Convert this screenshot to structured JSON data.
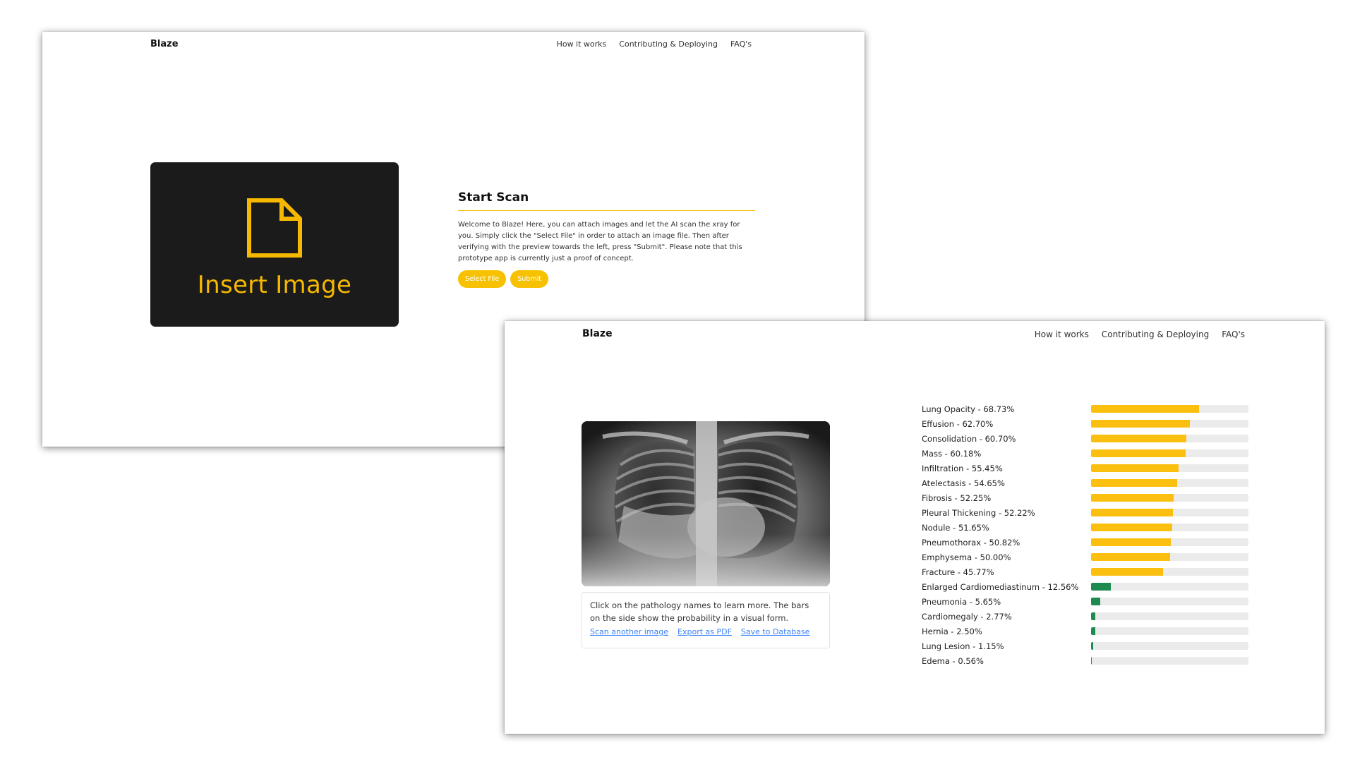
{
  "upload_page": {
    "brand": "Blaze",
    "nav": [
      "How it works",
      "Contributing & Deploying",
      "FAQ's"
    ],
    "dropzone": {
      "icon": "file-icon",
      "label": "Insert Image"
    },
    "panel": {
      "title": "Start Scan",
      "description": "Welcome to Blaze! Here, you can attach images and let the AI scan the xray for you. Simply click the \"Select File\" in order to attach an image file. Then after verifying with the preview towards the left, press \"Submit\". Please note that this prototype app is currently just a proof of concept.",
      "select_label": "Select File",
      "submit_label": "Submit"
    }
  },
  "results_page": {
    "brand": "Blaze",
    "nav": [
      "How it works",
      "Contributing & Deploying",
      "FAQ's"
    ],
    "caption": "Click on the pathology names to learn more. The bars on the side show the probability in a visual form.",
    "links": [
      "Scan another image",
      "Export as PDF",
      "Save to Database"
    ],
    "results": [
      {
        "label": "Lung Opacity - 68.73%",
        "value": 68.73
      },
      {
        "label": "Effusion - 62.70%",
        "value": 62.7
      },
      {
        "label": "Consolidation - 60.70%",
        "value": 60.7
      },
      {
        "label": "Mass - 60.18%",
        "value": 60.18
      },
      {
        "label": "Infiltration - 55.45%",
        "value": 55.45
      },
      {
        "label": "Atelectasis - 54.65%",
        "value": 54.65
      },
      {
        "label": "Fibrosis - 52.25%",
        "value": 52.25
      },
      {
        "label": "Pleural Thickening - 52.22%",
        "value": 52.22
      },
      {
        "label": "Nodule - 51.65%",
        "value": 51.65
      },
      {
        "label": "Pneumothorax - 50.82%",
        "value": 50.82
      },
      {
        "label": "Emphysema - 50.00%",
        "value": 50.0
      },
      {
        "label": "Fracture - 45.77%",
        "value": 45.77
      },
      {
        "label": "Enlarged Cardiomediastinum - 12.56%",
        "value": 12.56
      },
      {
        "label": "Pneumonia - 5.65%",
        "value": 5.65
      },
      {
        "label": "Cardiomegaly - 2.77%",
        "value": 2.77
      },
      {
        "label": "Hernia - 2.50%",
        "value": 2.5
      },
      {
        "label": "Lung Lesion - 1.15%",
        "value": 1.15
      },
      {
        "label": "Edema - 0.56%",
        "value": 0.56
      }
    ]
  },
  "colors": {
    "accent": "#f7b800",
    "high": "#fbbf0f",
    "low": "#1e8a50",
    "track": "#ebebeb",
    "link": "#3b82f6",
    "dark_panel": "#1b1b1b"
  }
}
